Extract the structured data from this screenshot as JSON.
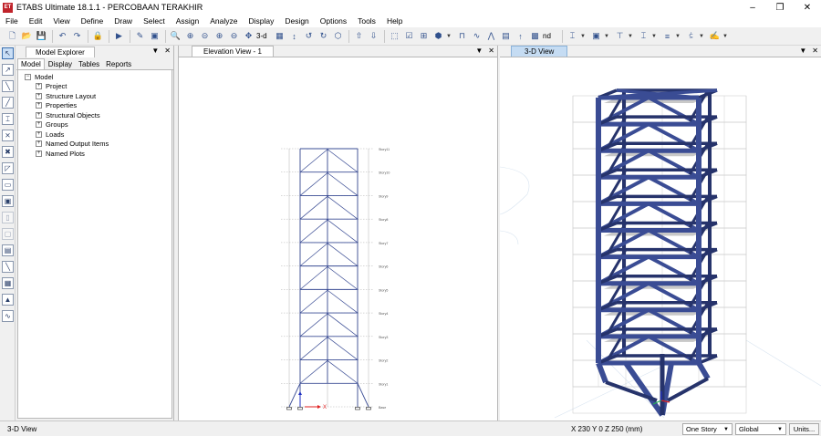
{
  "window": {
    "app_icon": "ET",
    "title": "ETABS Ultimate 18.1.1 - PERCOBAAN TERAKHIR"
  },
  "menu": [
    "File",
    "Edit",
    "View",
    "Define",
    "Draw",
    "Select",
    "Assign",
    "Analyze",
    "Display",
    "Design",
    "Options",
    "Tools",
    "Help"
  ],
  "toolbar": {
    "three_d_label": "3-d",
    "nd_label": "nd"
  },
  "explorer": {
    "title": "Model Explorer",
    "tabs": [
      "Model",
      "Display",
      "Tables",
      "Reports"
    ],
    "root": "Model",
    "items": [
      "Project",
      "Structure Layout",
      "Properties",
      "Structural Objects",
      "Groups",
      "Loads",
      "Named Output Items",
      "Named Plots"
    ]
  },
  "elevation": {
    "title": "Elevation View - 1",
    "stories": [
      "Story11",
      "Story10",
      "Story9",
      "Story8",
      "Story7",
      "Story6",
      "Story5",
      "Story4",
      "Story3",
      "Story2",
      "Story1",
      "Base"
    ],
    "axis_x": "X"
  },
  "view3d": {
    "title": "3-D View"
  },
  "status": {
    "left": "3-D View",
    "coords": "X 230  Y 0  Z 250 (mm)",
    "story_option": "One Story",
    "coord_system": "Global",
    "units_button": "Units..."
  },
  "colors": {
    "frame": "#3a4c94",
    "frame_dark": "#26336b",
    "slab": "#9a9a9a",
    "grid": "#b0b0b0",
    "accent_tab": "#c5dcf3"
  }
}
